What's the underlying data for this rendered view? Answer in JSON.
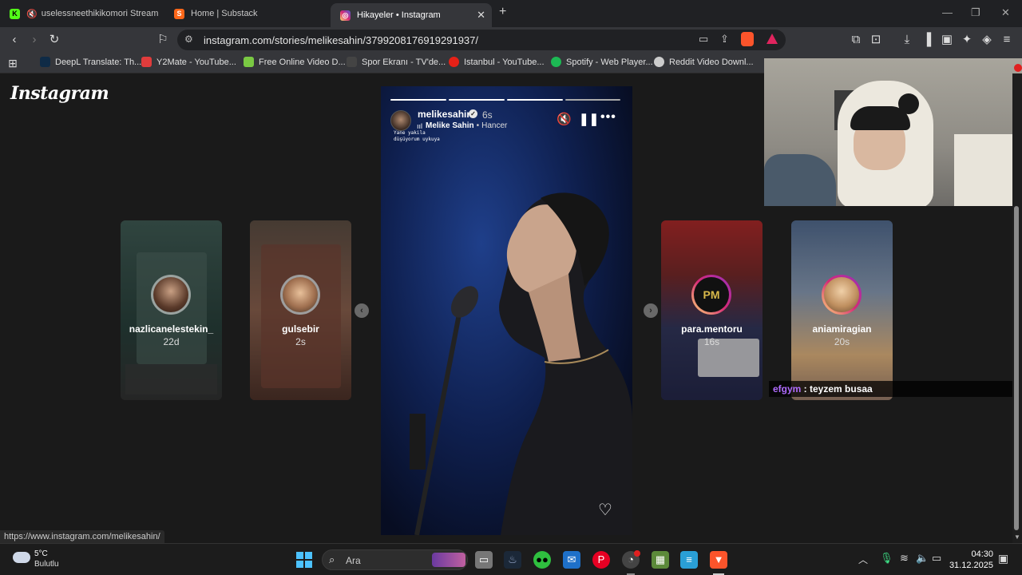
{
  "tabs": [
    {
      "title": "uselessneethikikomori Stream - V",
      "favicon": "kick-icon",
      "color": "#53fc18",
      "letter": "K",
      "muted": true
    },
    {
      "title": "Home | Substack",
      "favicon": "substack-icon",
      "color": "#ff6719",
      "letter": "S"
    },
    {
      "title": "Hikayeler • Instagram",
      "favicon": "instagram-icon",
      "color": "#d62976",
      "letter": "",
      "active": true
    }
  ],
  "toolbar": {
    "url": "instagram.com/stories/melikesahin/3799208176919291937/"
  },
  "bookmarks": [
    {
      "label": "DeepL Translate: Th...",
      "color": "#0f2b46"
    },
    {
      "label": "Y2Mate - YouTube...",
      "color": "#e03c3c"
    },
    {
      "label": "Free Online Video D...",
      "color": "#7ac943"
    },
    {
      "label": "Spor Ekranı - TV'de...",
      "color": "#444444"
    },
    {
      "label": "Istanbul - YouTube...",
      "color": "#e62117"
    },
    {
      "label": "Spotify - Web Player...",
      "color": "#1db954"
    },
    {
      "label": "Reddit Video Downl...",
      "color": "#cccccc"
    }
  ],
  "page": {
    "logo": "Instagram",
    "status_url": "https://www.instagram.com/melikesahin/"
  },
  "side_stories": [
    {
      "username": "nazlicanelestekin_",
      "time": "22d",
      "bg": "#3d5a52",
      "ring": "#9aa3a0"
    },
    {
      "username": "gulsebir",
      "time": "2s",
      "bg": "#5a4e45",
      "ring": "#9e9e9e"
    },
    {
      "username": "para.mentoru",
      "time": "16s",
      "bg": "#3a3f6a",
      "ring": "#d62976"
    },
    {
      "username": "aniamiragian",
      "time": "20s",
      "bg": "#5b6f8f",
      "ring": "#d62976"
    }
  ],
  "story": {
    "username": "melikesahin",
    "time": "6s",
    "music_artist": "Melike Sahin",
    "music_title": "Hancer",
    "overlay_lines": [
      "Yane yakila",
      "düşüyorum uykuya"
    ]
  },
  "chat": {
    "user": "efgym",
    "message": " : teyzem busaa",
    "user_color": "#b06cff"
  },
  "taskbar": {
    "weather_temp": "5°C",
    "weather_desc": "Bulutlu",
    "search_placeholder": "Ara",
    "time": "04:30",
    "date": "31.12.2025"
  }
}
